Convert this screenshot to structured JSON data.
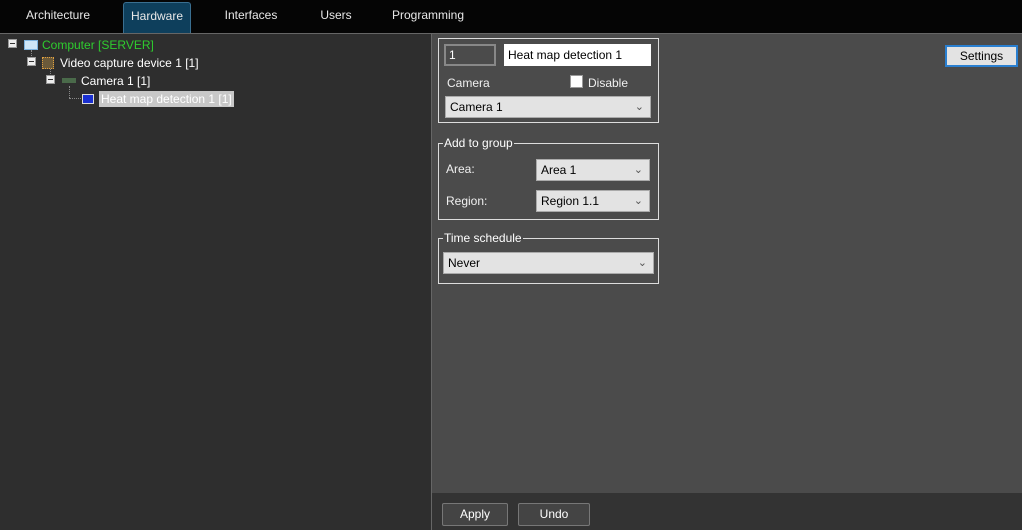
{
  "tabs": [
    {
      "label": "Architecture"
    },
    {
      "label": "Hardware",
      "active": true
    },
    {
      "label": "Interfaces"
    },
    {
      "label": "Users"
    },
    {
      "label": "Programming"
    }
  ],
  "tree": {
    "computer": "Computer [SERVER]",
    "device": "Video capture device 1 [1]",
    "camera": "Camera 1 [1]",
    "detector": "Heat map detection 1 [1]"
  },
  "form": {
    "id_value": "1",
    "name_value": "Heat map detection 1",
    "camera_label": "Camera",
    "disable_label": "Disable",
    "disable_checked": false,
    "camera_value": "Camera 1",
    "group_legend": "Add to group",
    "area_label": "Area:",
    "area_value": "Area 1",
    "region_label": "Region:",
    "region_value": "Region 1.1",
    "schedule_legend": "Time schedule",
    "schedule_value": "Never",
    "settings_label": "Settings"
  },
  "footer": {
    "apply_label": "Apply",
    "undo_label": "Undo"
  },
  "colors": {
    "computer_text": "#2ecc2e",
    "selected_bg": "#c8c8c8",
    "active_tab": "#0e3f5c"
  }
}
